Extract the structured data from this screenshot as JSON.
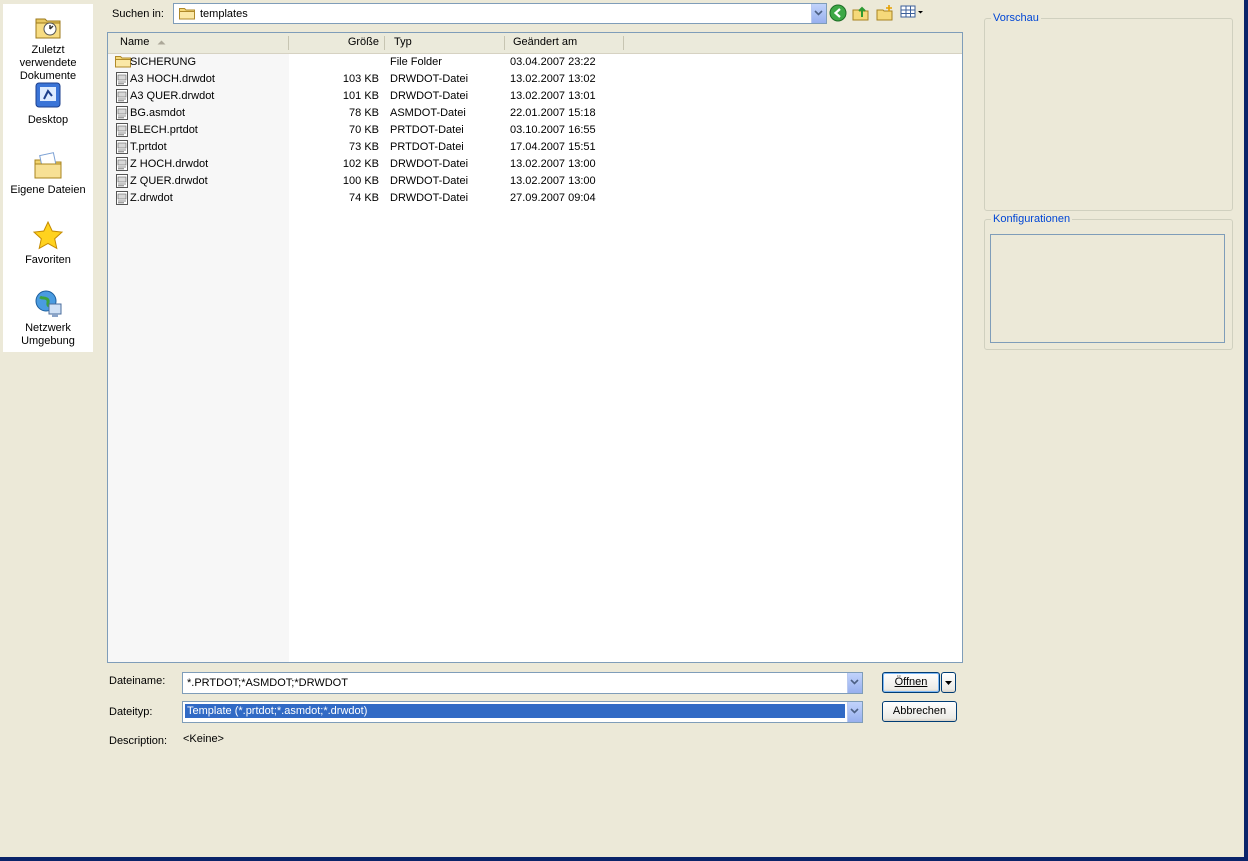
{
  "places": [
    {
      "label": "Zuletzt verwendete Dokumente",
      "icon": "recent-documents-icon"
    },
    {
      "label": "Desktop",
      "icon": "desktop-icon"
    },
    {
      "label": "Eigene Dateien",
      "icon": "my-documents-icon"
    },
    {
      "label": "Favoriten",
      "icon": "favorites-star-icon"
    },
    {
      "label": "Netzwerk Umgebung",
      "icon": "network-globe-icon"
    }
  ],
  "lookin": {
    "label": "Suchen in:",
    "value": "templates"
  },
  "columns": {
    "name": "Name",
    "size": "Größe",
    "type": "Typ",
    "modified": "Geändert am"
  },
  "files": [
    {
      "name": "SICHERUNG",
      "size": "",
      "type": "File Folder",
      "modified": "03.04.2007 23:22",
      "kind": "folder"
    },
    {
      "name": "A3  HOCH.drwdot",
      "size": "103 KB",
      "type": "DRWDOT-Datei",
      "modified": "13.02.2007 13:02",
      "kind": "file"
    },
    {
      "name": "A3  QUER.drwdot",
      "size": "101 KB",
      "type": "DRWDOT-Datei",
      "modified": "13.02.2007 13:01",
      "kind": "file"
    },
    {
      "name": "BG.asmdot",
      "size": "78 KB",
      "type": "ASMDOT-Datei",
      "modified": "22.01.2007 15:18",
      "kind": "file"
    },
    {
      "name": "BLECH.prtdot",
      "size": "70 KB",
      "type": "PRTDOT-Datei",
      "modified": "03.10.2007 16:55",
      "kind": "file"
    },
    {
      "name": "T.prtdot",
      "size": "73 KB",
      "type": "PRTDOT-Datei",
      "modified": "17.04.2007 15:51",
      "kind": "file"
    },
    {
      "name": "Z  HOCH.drwdot",
      "size": "102 KB",
      "type": "DRWDOT-Datei",
      "modified": "13.02.2007 13:00",
      "kind": "file"
    },
    {
      "name": "Z  QUER.drwdot",
      "size": "100 KB",
      "type": "DRWDOT-Datei",
      "modified": "13.02.2007 13:00",
      "kind": "file"
    },
    {
      "name": "Z.drwdot",
      "size": "74 KB",
      "type": "DRWDOT-Datei",
      "modified": "27.09.2007 09:04",
      "kind": "file"
    }
  ],
  "filename": {
    "label": "Dateiname:",
    "value": "*.PRTDOT;*ASMDOT;*DRWDOT"
  },
  "filetype": {
    "label": "Dateityp:",
    "value": "Template (*.prtdot;*.asmdot;*.drwdot)"
  },
  "description": {
    "label": "Description:",
    "value": "<Keine>"
  },
  "buttons": {
    "open": "Öffnen",
    "cancel": "Abbrechen"
  },
  "panels": {
    "preview": "Vorschau",
    "configurations": "Konfigurationen"
  },
  "colors": {
    "accent": "#316AC5",
    "group_title": "#0046D5",
    "dialog_bg": "#ECE9D8"
  }
}
